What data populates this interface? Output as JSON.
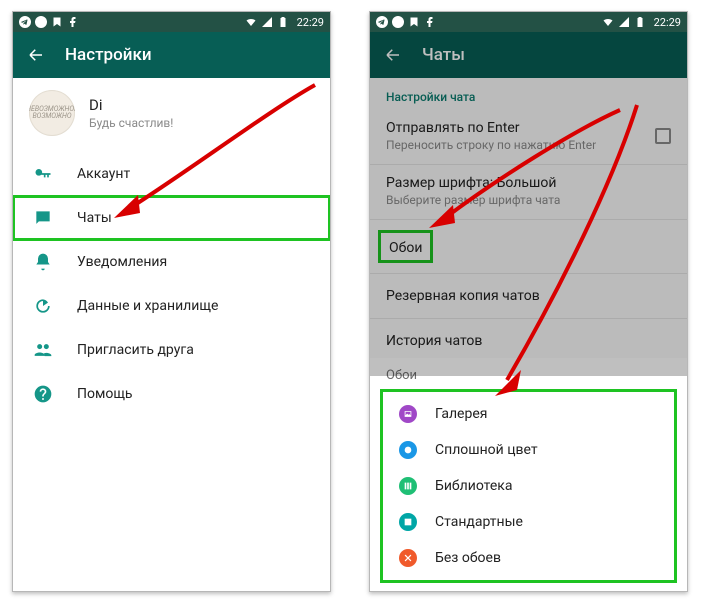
{
  "status": {
    "time": "22:29"
  },
  "phoneA": {
    "title": "Настройки",
    "profile": {
      "name": "Di",
      "status": "Будь счастлив!",
      "avatar_lines": [
        "НЕВОЗМОЖНОЕ",
        "ВОЗМОЖНО"
      ]
    },
    "items": [
      {
        "label": "Аккаунт"
      },
      {
        "label": "Чаты"
      },
      {
        "label": "Уведомления"
      },
      {
        "label": "Данные и хранилище"
      },
      {
        "label": "Пригласить друга"
      },
      {
        "label": "Помощь"
      }
    ]
  },
  "phoneB": {
    "title": "Чаты",
    "section_head": "Настройки чата",
    "rows": {
      "enter": {
        "title": "Отправлять по Enter",
        "sub": "Переносить строку по нажатию Enter"
      },
      "font": {
        "title": "Размер шрифта: Большой",
        "sub": "Выберите размер шрифта чата"
      },
      "wallpaper": {
        "title": "Обои"
      },
      "backup": {
        "title": "Резервная копия чатов"
      },
      "history": {
        "title": "История чатов"
      }
    },
    "sheet": {
      "title": "Обои",
      "items": [
        {
          "label": "Галерея"
        },
        {
          "label": "Сплошной цвет"
        },
        {
          "label": "Библиотека"
        },
        {
          "label": "Стандартные"
        },
        {
          "label": "Без обоев"
        }
      ]
    }
  }
}
